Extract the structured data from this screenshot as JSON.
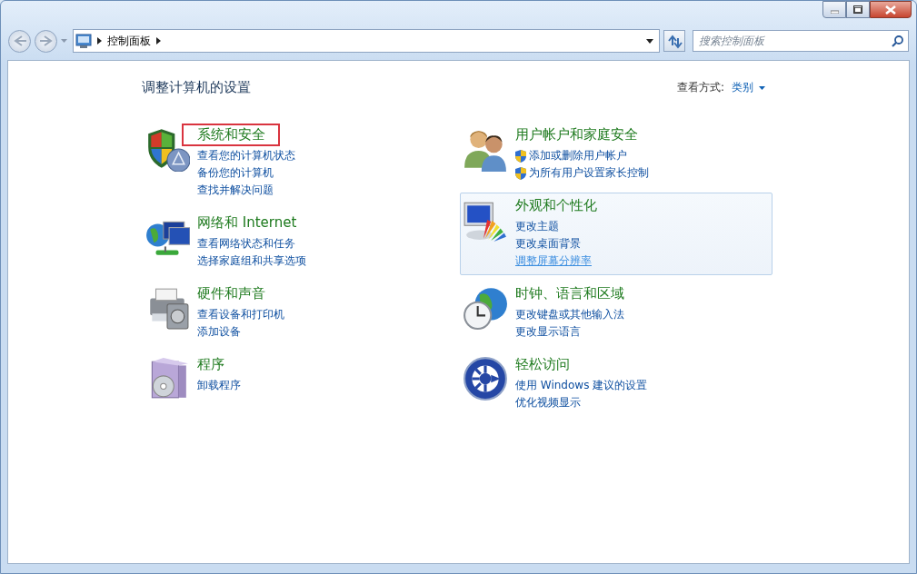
{
  "address_bar": {
    "path": [
      "控制面板"
    ]
  },
  "search": {
    "placeholder": "搜索控制面板"
  },
  "heading": "调整计算机的设置",
  "view_by": {
    "label": "查看方式:",
    "value": "类别"
  },
  "columns": [
    [
      {
        "kind": "security",
        "title": "系统和安全",
        "highlighted": true,
        "hovered": false,
        "links": [
          {
            "text": "查看您的计算机状态",
            "shield": false,
            "hovered": false
          },
          {
            "text": "备份您的计算机",
            "shield": false,
            "hovered": false
          },
          {
            "text": "查找并解决问题",
            "shield": false,
            "hovered": false
          }
        ]
      },
      {
        "kind": "network",
        "title": "网络和 Internet",
        "highlighted": false,
        "hovered": false,
        "links": [
          {
            "text": "查看网络状态和任务",
            "shield": false,
            "hovered": false
          },
          {
            "text": "选择家庭组和共享选项",
            "shield": false,
            "hovered": false
          }
        ]
      },
      {
        "kind": "hardware",
        "title": "硬件和声音",
        "highlighted": false,
        "hovered": false,
        "links": [
          {
            "text": "查看设备和打印机",
            "shield": false,
            "hovered": false
          },
          {
            "text": "添加设备",
            "shield": false,
            "hovered": false
          }
        ]
      },
      {
        "kind": "programs",
        "title": "程序",
        "highlighted": false,
        "hovered": false,
        "links": [
          {
            "text": "卸载程序",
            "shield": false,
            "hovered": false
          }
        ]
      }
    ],
    [
      {
        "kind": "users",
        "title": "用户帐户和家庭安全",
        "highlighted": false,
        "hovered": false,
        "links": [
          {
            "text": "添加或删除用户帐户",
            "shield": true,
            "hovered": false
          },
          {
            "text": "为所有用户设置家长控制",
            "shield": true,
            "hovered": false
          }
        ]
      },
      {
        "kind": "appearance",
        "title": "外观和个性化",
        "highlighted": false,
        "hovered": true,
        "links": [
          {
            "text": "更改主题",
            "shield": false,
            "hovered": false
          },
          {
            "text": "更改桌面背景",
            "shield": false,
            "hovered": false
          },
          {
            "text": "调整屏幕分辨率",
            "shield": false,
            "hovered": true
          }
        ]
      },
      {
        "kind": "clock",
        "title": "时钟、语言和区域",
        "highlighted": false,
        "hovered": false,
        "links": [
          {
            "text": "更改键盘或其他输入法",
            "shield": false,
            "hovered": false
          },
          {
            "text": "更改显示语言",
            "shield": false,
            "hovered": false
          }
        ]
      },
      {
        "kind": "access",
        "title": "轻松访问",
        "highlighted": false,
        "hovered": false,
        "links": [
          {
            "text": "使用 Windows 建议的设置",
            "shield": false,
            "hovered": false
          },
          {
            "text": "优化视频显示",
            "shield": false,
            "hovered": false
          }
        ]
      }
    ]
  ]
}
